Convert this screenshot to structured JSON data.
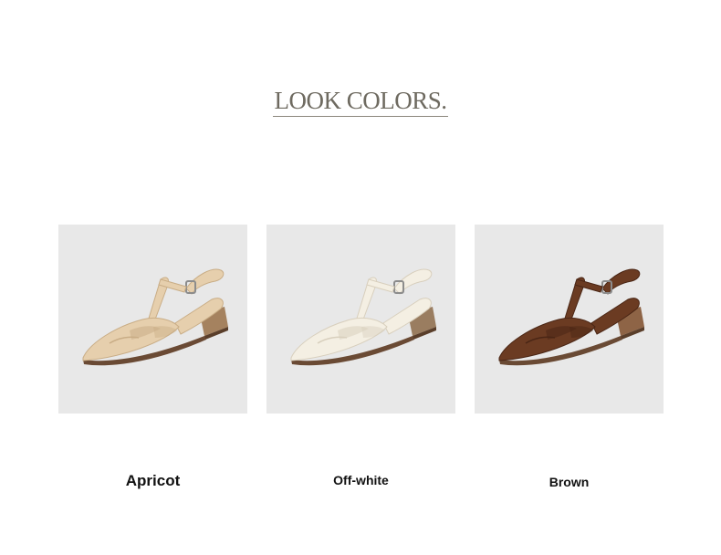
{
  "header": {
    "title": "LOOK COLORS."
  },
  "products": [
    {
      "label": "Apricot",
      "color": "#e6cfad",
      "shade": "#c9ad86",
      "heel": "#a5825f",
      "icon": "sandal-apricot-image"
    },
    {
      "label": "Off-white",
      "color": "#f4efe3",
      "shade": "#d8cfbd",
      "heel": "#9a7d60",
      "icon": "sandal-offwhite-image"
    },
    {
      "label": "Brown",
      "color": "#6b3b22",
      "shade": "#4a2615",
      "heel": "#8e6446",
      "icon": "sandal-brown-image"
    }
  ]
}
